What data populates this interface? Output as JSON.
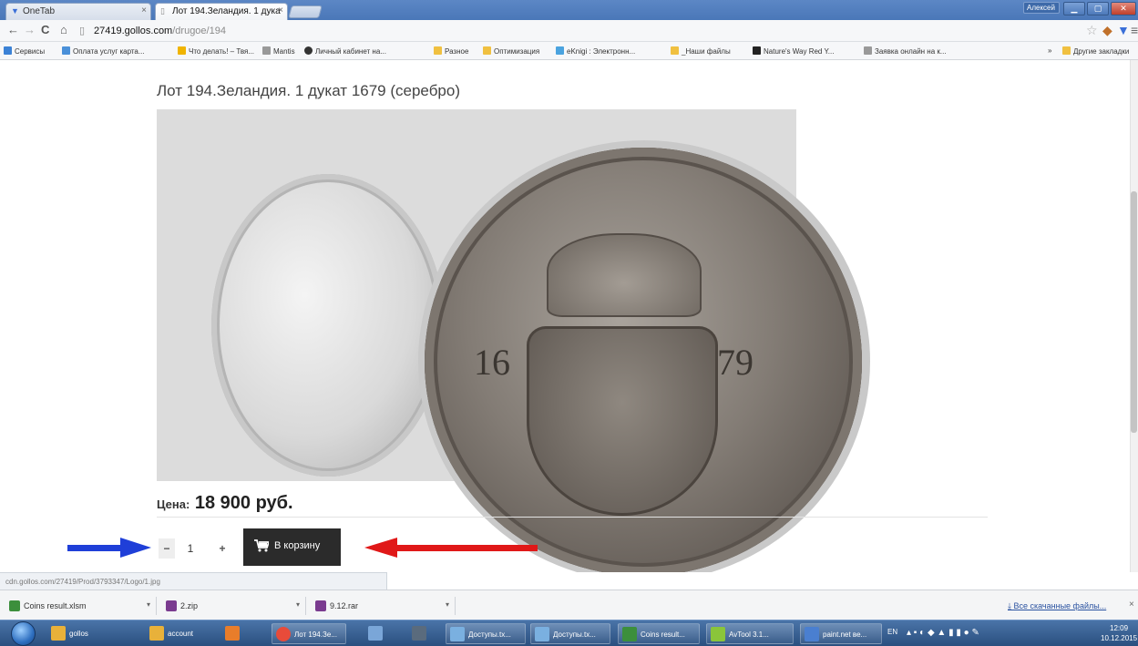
{
  "browser": {
    "tabs": [
      {
        "label": "OneTab",
        "active": false
      },
      {
        "label": "Лот 194.Зеландия. 1 дука",
        "active": true
      }
    ],
    "profile_label": "Алексей",
    "url_host": "27419.gollos.com",
    "url_path": "/drugoe/194"
  },
  "bookmarks": [
    {
      "label": "Сервисы",
      "color": "#3b82d6"
    },
    {
      "label": "Оплата услуг карта...",
      "color": "#4a90d9"
    },
    {
      "label": "Что делать! – Твя...",
      "color": "#f0b400"
    },
    {
      "label": "Mantis",
      "color": "#999999"
    },
    {
      "label": "Личный кабинет на...",
      "color": "#333333"
    },
    {
      "label": "Разное",
      "color": "#f0c040"
    },
    {
      "label": "Оптимизация",
      "color": "#f0c040"
    },
    {
      "label": "eKnigi : Электронн...",
      "color": "#4aa3df"
    },
    {
      "label": "_Наши файлы",
      "color": "#f0c040"
    },
    {
      "label": "Nature's Way Red Y...",
      "color": "#222222"
    },
    {
      "label": "Заявка онлайн на к...",
      "color": "#999999"
    }
  ],
  "bookmarks_other": "Другие закладки",
  "bookmarks_overflow": "»",
  "page": {
    "lot_title": "Лот 194.Зеландия. 1 дукат 1679 (серебро)",
    "price_label": "Цена:",
    "price_value": "18 900 руб.",
    "quantity": "1",
    "qty_minus": "−",
    "qty_plus": "+",
    "cart_button": "В корзину",
    "coin_year_left": "16",
    "coin_year_right": "79"
  },
  "status_url": "cdn.gollos.com/27419/Prod/3793347/Logo/1.jpg",
  "downloads": {
    "items": [
      {
        "label": "Coins result.xlsm",
        "color": "#3c8f3c"
      },
      {
        "label": "2.zip",
        "color": "#7a3b8f"
      },
      {
        "label": "9.12.rar",
        "color": "#7a3b8f"
      }
    ],
    "all_label": "Все скачанные файлы...",
    "close": "×"
  },
  "taskbar": {
    "items": [
      {
        "label": "gollos",
        "color": "#e8b13a",
        "button": false
      },
      {
        "label": "account",
        "color": "#e8b13a",
        "button": false
      },
      {
        "label": "",
        "color": "#e87d2a",
        "button": false
      },
      {
        "label": "Лот 194.Зе...",
        "color": "#e84b3a",
        "button": true
      },
      {
        "label": "",
        "color": "#7aa6d8",
        "button": false
      },
      {
        "label": "",
        "color": "#5a6b7d",
        "button": false
      },
      {
        "label": "Доступы.tx...",
        "color": "#7ab0e0",
        "button": true
      },
      {
        "label": "Доступы.tx...",
        "color": "#7ab0e0",
        "button": true
      },
      {
        "label": "Coins result...",
        "color": "#3c8f3c",
        "button": true
      },
      {
        "label": "AvTool 3.1...",
        "color": "#8ac53a",
        "button": true
      },
      {
        "label": "paint.net ве...",
        "color": "#4a7fd0",
        "button": true
      }
    ],
    "lang": "EN",
    "time": "12:09",
    "date": "10.12.2015"
  }
}
